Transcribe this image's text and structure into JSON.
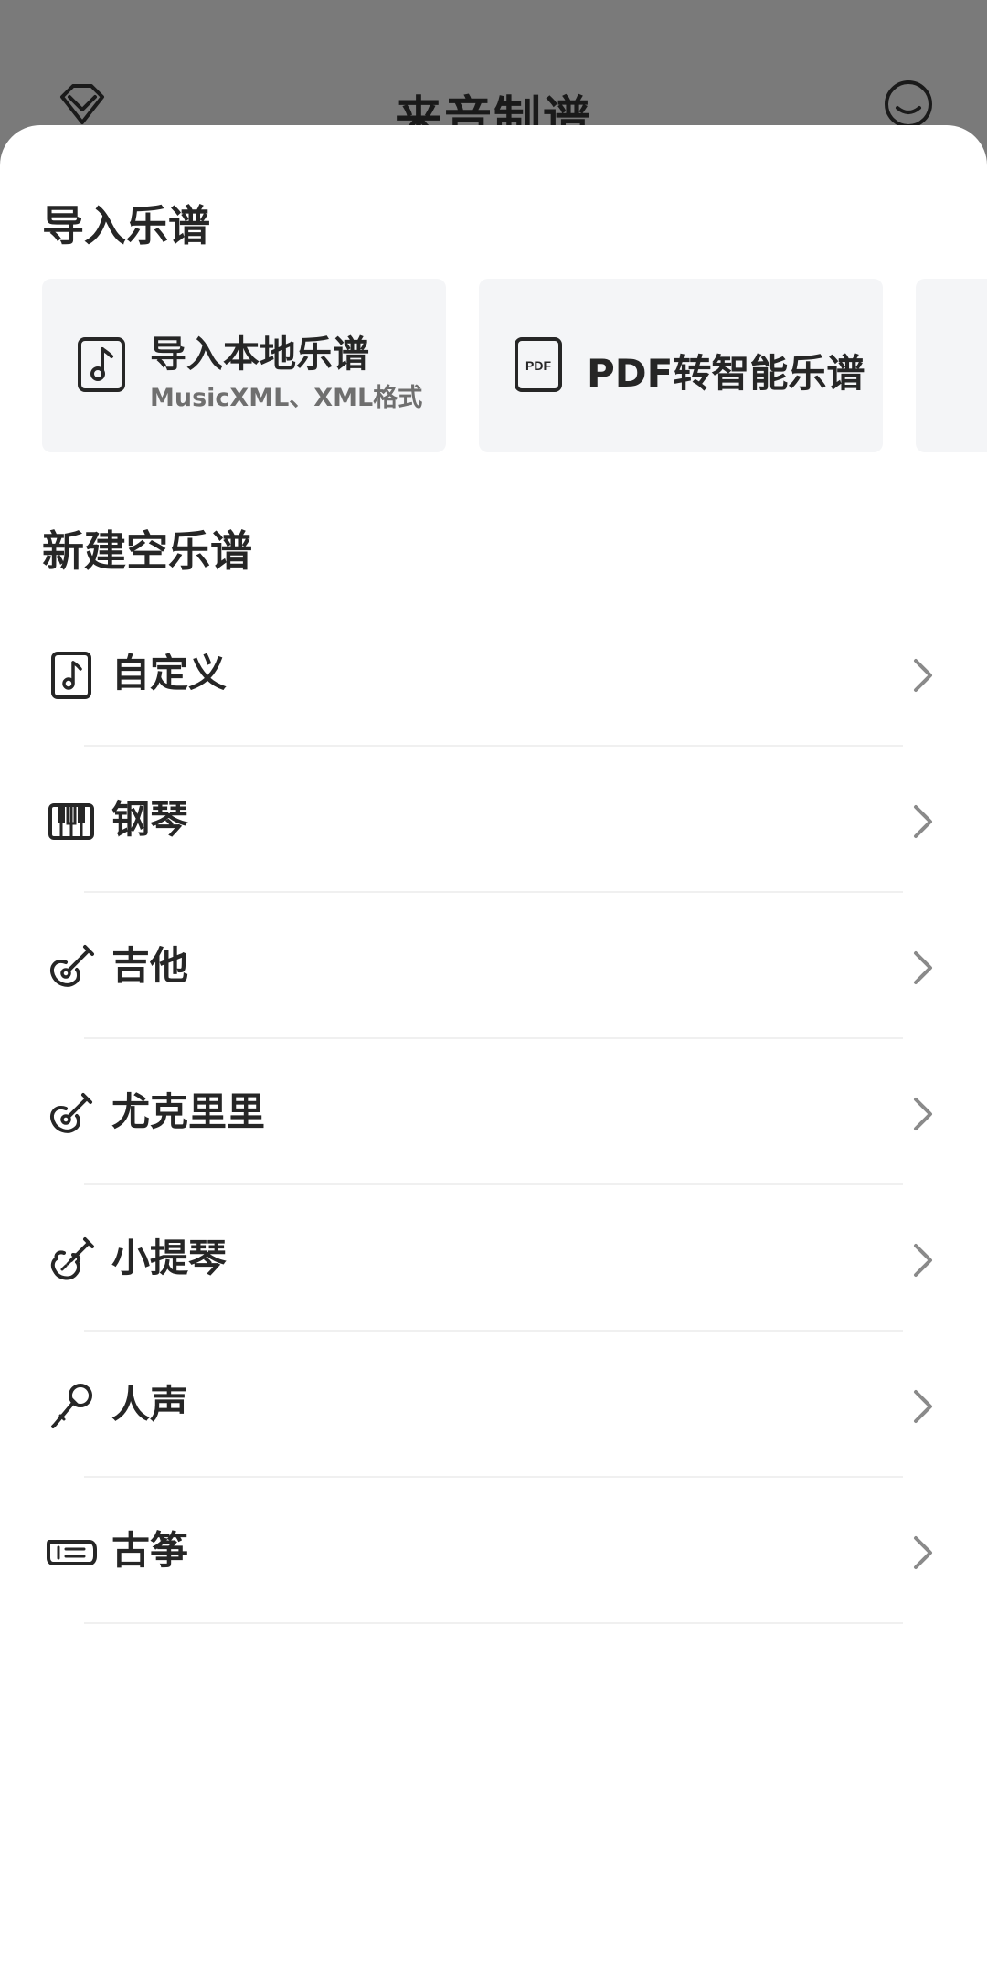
{
  "background": {
    "title": "来音制谱",
    "left_icon": "diamond-chevron-icon",
    "right_icon": "user-profile-icon"
  },
  "sheet": {
    "import_section": {
      "title": "导入乐谱",
      "cards": [
        {
          "title": "导入本地乐谱",
          "subtitle": "MusicXML、XML格式",
          "icon": "music-file-icon"
        },
        {
          "title": "PDF转智能乐谱",
          "icon": "pdf-file-icon",
          "icon_text": "PDF"
        }
      ]
    },
    "new_section": {
      "title": "新建空乐谱",
      "items": [
        {
          "label": "自定义",
          "icon": "music-note-file-icon"
        },
        {
          "label": "钢琴",
          "icon": "piano-icon"
        },
        {
          "label": "吉他",
          "icon": "guitar-icon"
        },
        {
          "label": "尤克里里",
          "icon": "ukulele-icon"
        },
        {
          "label": "小提琴",
          "icon": "violin-icon"
        },
        {
          "label": "人声",
          "icon": "microphone-icon"
        },
        {
          "label": "古筝",
          "icon": "guzheng-icon"
        }
      ]
    }
  },
  "colors": {
    "overlay": "#7a7a7a",
    "sheet": "#ffffff",
    "card_bg": "#f4f5f7",
    "text_primary": "#262626",
    "text_secondary": "#6f6f6f",
    "chevron": "#8a8a8a",
    "divider": "#f0f0f0"
  }
}
